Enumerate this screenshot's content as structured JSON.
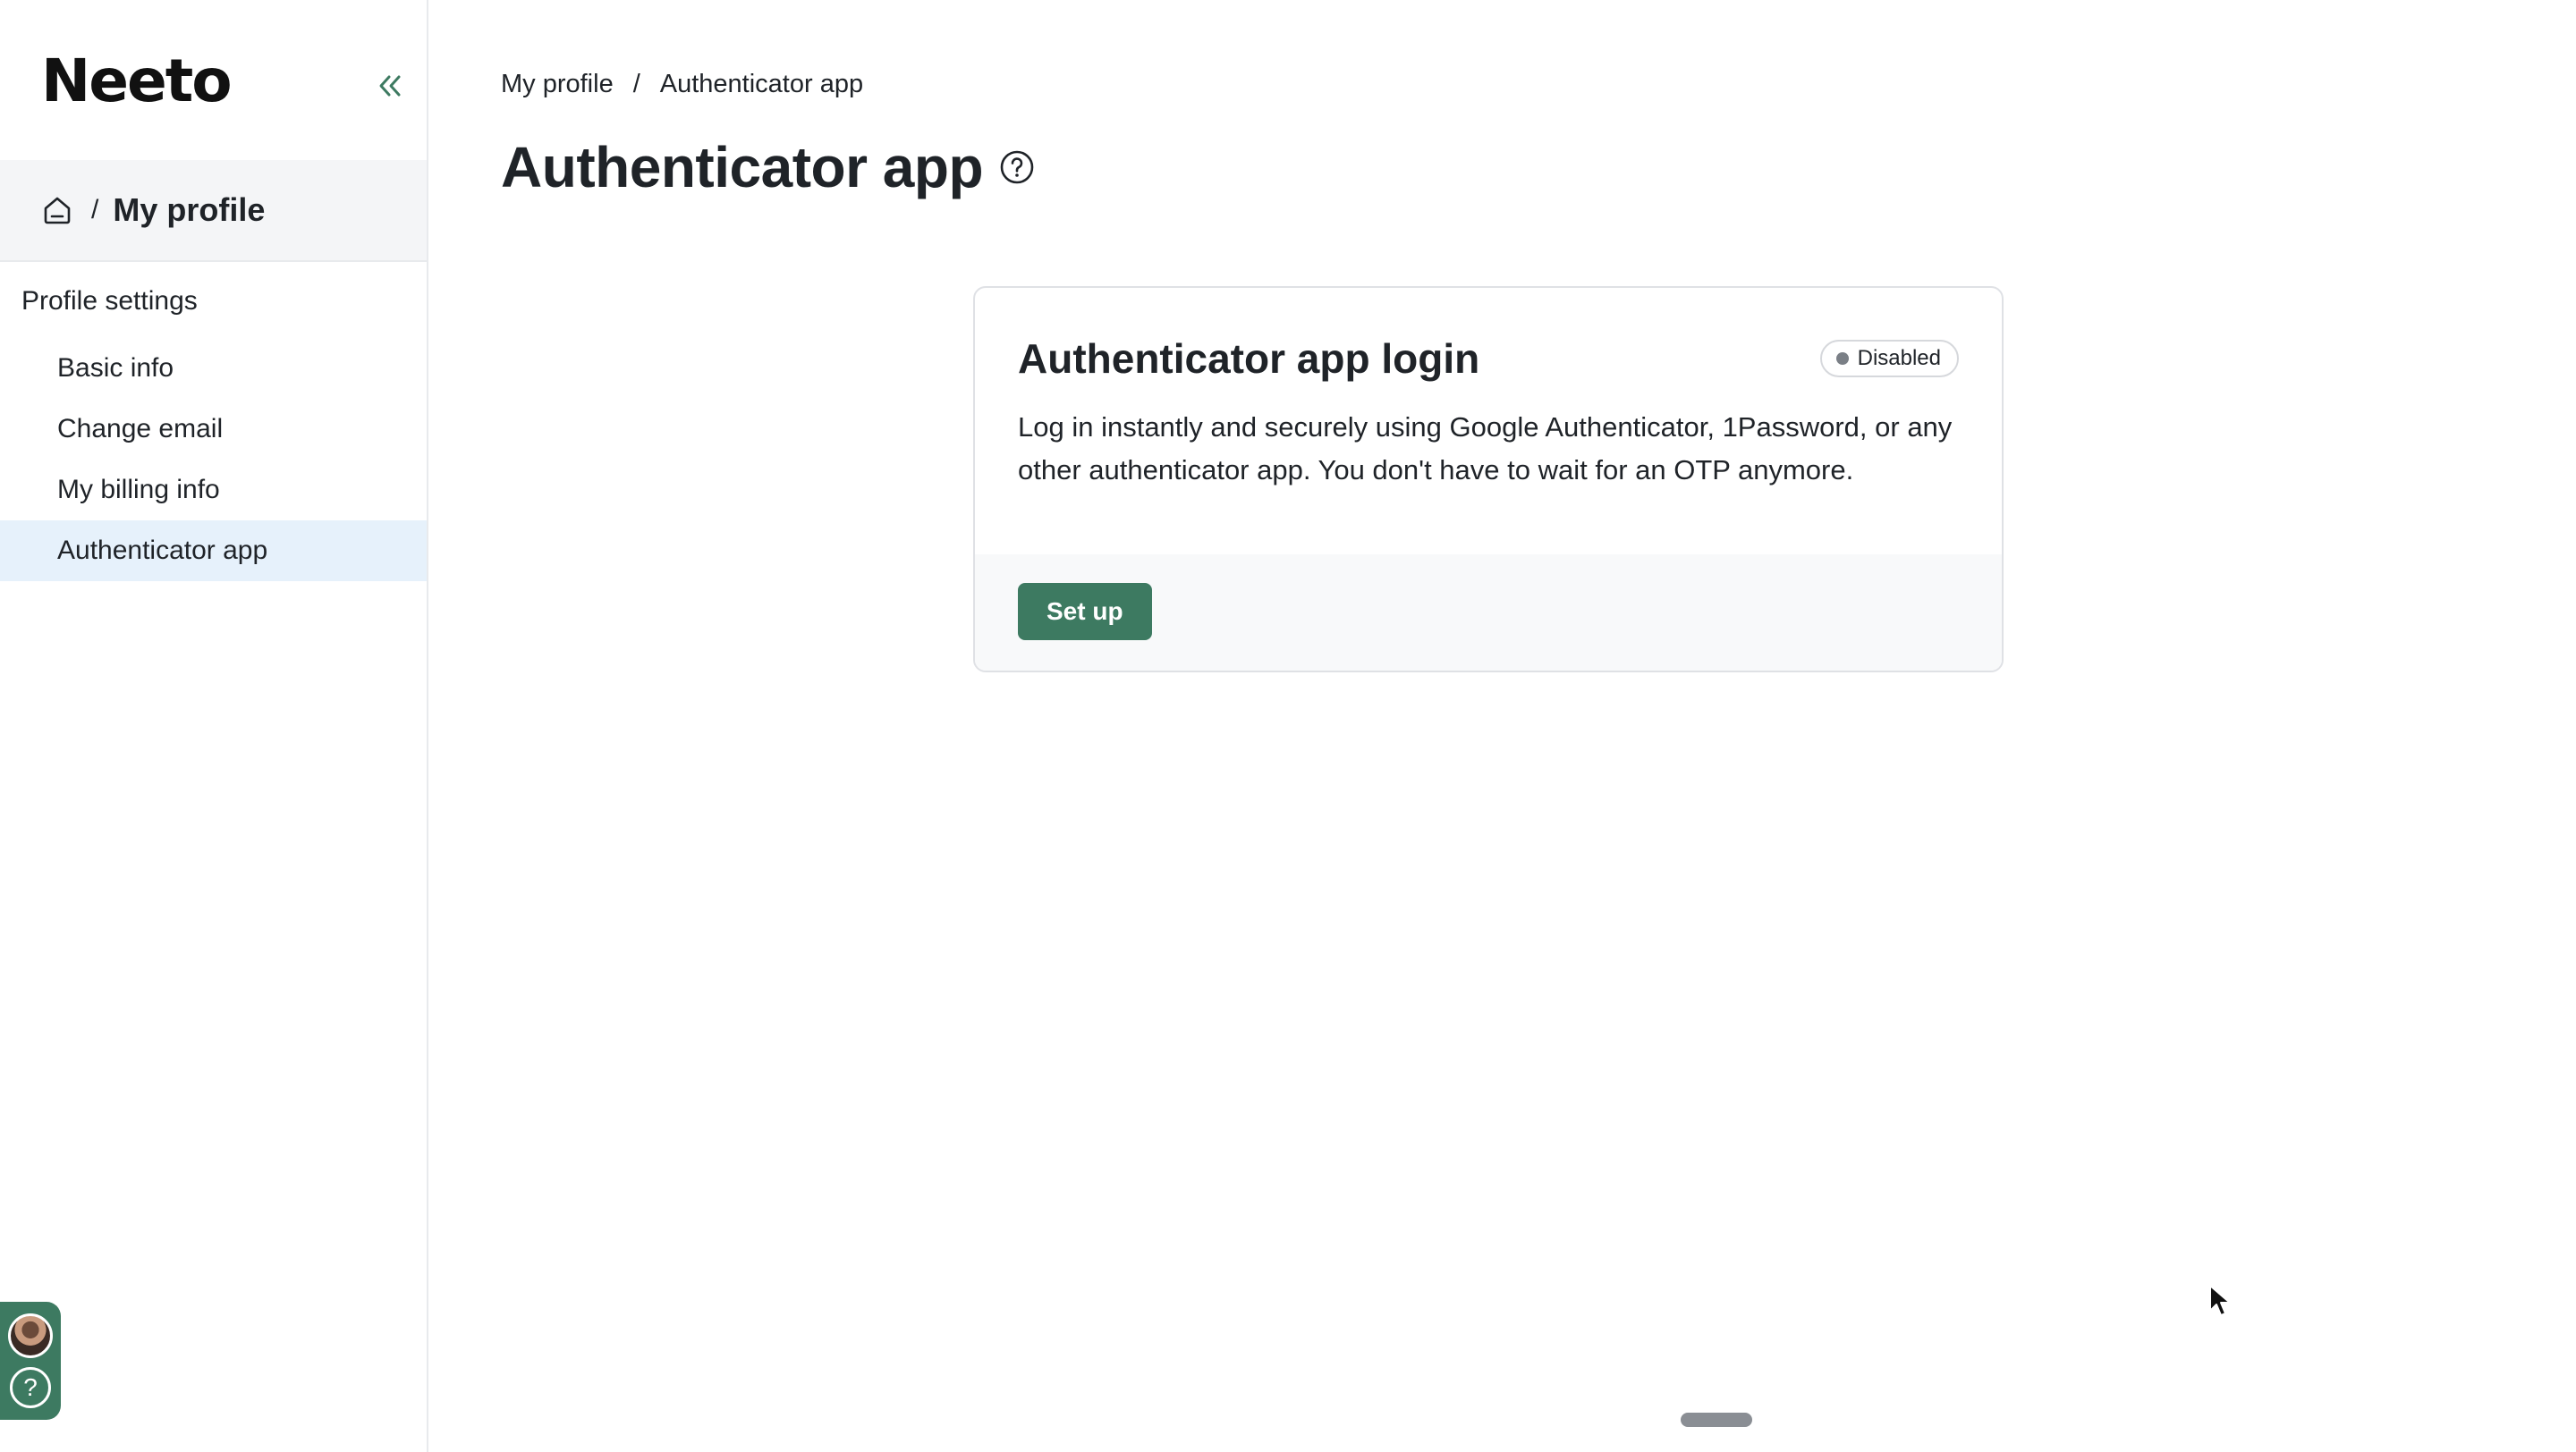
{
  "sidebar": {
    "logo": "Neeto",
    "breadcrumb_sep": "/",
    "breadcrumb_title": "My profile",
    "section_title": "Profile settings",
    "items": [
      {
        "label": "Basic info"
      },
      {
        "label": "Change email"
      },
      {
        "label": "My billing info"
      },
      {
        "label": "Authenticator app"
      }
    ],
    "help_glyph": "?"
  },
  "main": {
    "breadcrumb": {
      "root": "My profile",
      "sep": "/",
      "current": "Authenticator app"
    },
    "page_title": "Authenticator app",
    "card": {
      "title": "Authenticator app login",
      "status": "Disabled",
      "description": "Log in instantly and securely using Google Authenticator, 1Password, or any other authenticator app. You don't have to wait for an OTP anymore.",
      "action_label": "Set up"
    }
  },
  "colors": {
    "accent": "#3d7a61",
    "active_nav_bg": "#e6f1fb",
    "logo_mark": "#2e9e5b"
  },
  "icons": [
    "collapse-sidebar-icon",
    "home-icon",
    "help-circle-icon",
    "user-avatar",
    "cursor-pointer-icon"
  ]
}
